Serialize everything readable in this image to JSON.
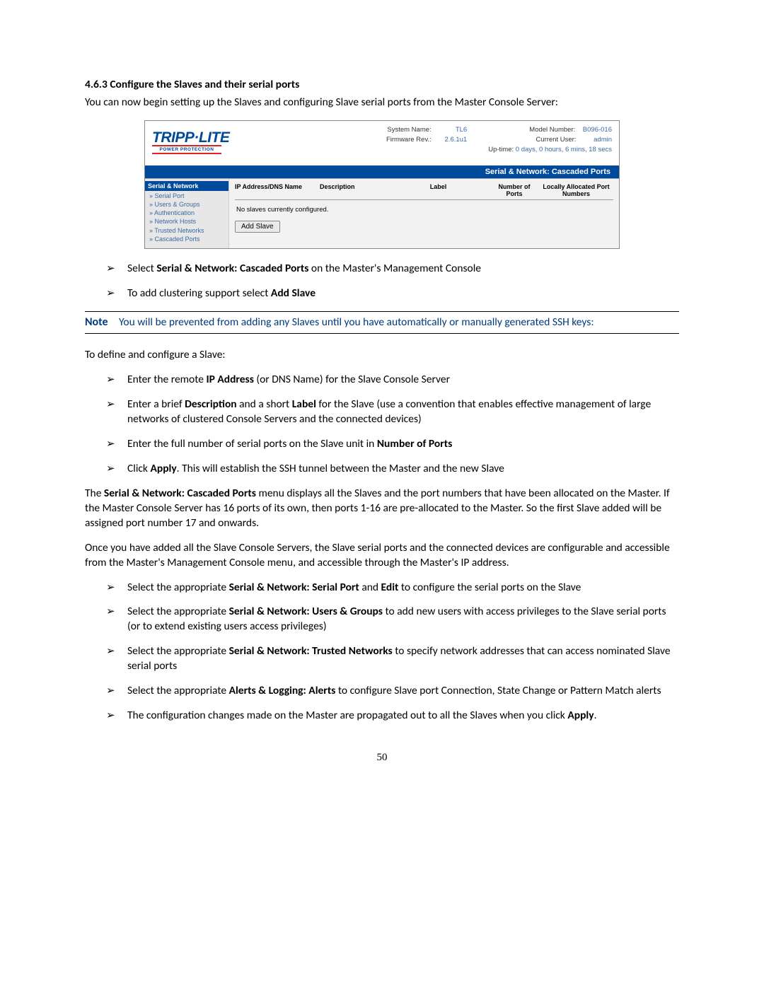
{
  "heading": "4.6.3 Configure the Slaves and their serial ports",
  "intro": "You can now begin setting up the Slaves and configuring Slave serial ports from the Master Console Server:",
  "screenshot": {
    "logo_main": "TRIPP·LITE",
    "logo_sub": "POWER PROTECTION",
    "info_left": [
      {
        "label": "System Name:",
        "value": "TL6"
      },
      {
        "label": "Firmware Rev.:",
        "value": "2.6.1u1"
      }
    ],
    "info_right": [
      {
        "label": "Model Number:",
        "value": "B096-016"
      },
      {
        "label": "Current User:",
        "value": "admin"
      }
    ],
    "uptime_label": "Up-time:",
    "uptime_value": "0 days, 0 hours, 6 mins, 18 secs",
    "blue_bar": "Serial & Network: Cascaded Ports",
    "side_head": "Serial & Network",
    "side_items": [
      "Serial Port",
      "Users & Groups",
      "Authentication",
      "Network Hosts",
      "Trusted Networks",
      "Cascaded Ports"
    ],
    "cols": {
      "ip": "IP Address/DNS Name",
      "desc": "Description",
      "label": "Label",
      "num": "Number of Ports",
      "alloc": "Locally Allocated Port Numbers"
    },
    "empty_msg": "No slaves currently configured.",
    "add_btn": "Add Slave"
  },
  "bullets1": [
    {
      "pre": "Select ",
      "b": "Serial & Network: Cascaded Ports",
      "post": " on the Master's Management Console"
    },
    {
      "pre": "To add clustering support select ",
      "b": "Add Slave",
      "post": ""
    }
  ],
  "note_label": "Note",
  "note_text": "You will be prevented from adding any Slaves until you have automatically or manually generated SSH keys:",
  "define_intro": "To define and configure a Slave:",
  "bullets2": [
    [
      {
        "t": "Enter the remote "
      },
      {
        "b": "IP Address"
      },
      {
        "t": " (or DNS Name) for the Slave Console Server"
      }
    ],
    [
      {
        "t": "Enter a brief "
      },
      {
        "b": "Description"
      },
      {
        "t": " and a short "
      },
      {
        "b": "Label"
      },
      {
        "t": " for the Slave (use a convention that enables effective management of large networks of clustered Console Servers and the connected devices)"
      }
    ],
    [
      {
        "t": "Enter the full number of serial ports on the Slave unit in "
      },
      {
        "b": "Number of Ports"
      }
    ],
    [
      {
        "t": "Click "
      },
      {
        "b": "Apply"
      },
      {
        "t": ". This will establish the SSH tunnel between the Master and the new Slave"
      }
    ]
  ],
  "para1": [
    {
      "t": "The "
    },
    {
      "b": "Serial & Network: Cascaded Ports"
    },
    {
      "t": " menu displays all the Slaves and the port numbers that have been allocated on the Master. If the Master Console Server has 16 ports of its own, then ports 1-16 are pre-allocated to the Master. So the first Slave added will be assigned port number 17 and onwards."
    }
  ],
  "para2": "Once you have added all the Slave Console Servers, the Slave serial ports and the connected devices are configurable and accessible from the Master's Management Console menu, and accessible through the Master's IP address.",
  "bullets3": [
    [
      {
        "t": "Select the appropriate "
      },
      {
        "b": "Serial & Network: Serial Port"
      },
      {
        "t": " and "
      },
      {
        "b": "Edit"
      },
      {
        "t": " to configure the serial ports on the Slave"
      }
    ],
    [
      {
        "t": "Select the appropriate "
      },
      {
        "b": "Serial & Network: Users & Groups"
      },
      {
        "t": " to add new users with access privileges to the Slave serial ports (or to extend existing users access privileges)"
      }
    ],
    [
      {
        "t": "Select the appropriate "
      },
      {
        "b": "Serial & Network: Trusted Networks"
      },
      {
        "t": " to specify network addresses that can access nominated Slave serial ports"
      }
    ],
    [
      {
        "t": "Select the appropriate "
      },
      {
        "b": "Alerts & Logging: Alerts"
      },
      {
        "t": " to configure Slave port Connection, State Change or Pattern Match alerts"
      }
    ],
    [
      {
        "t": "The configuration changes made on the Master are propagated out to all the Slaves when you click "
      },
      {
        "b": "Apply"
      },
      {
        "t": "."
      }
    ]
  ],
  "pagenum": "50"
}
